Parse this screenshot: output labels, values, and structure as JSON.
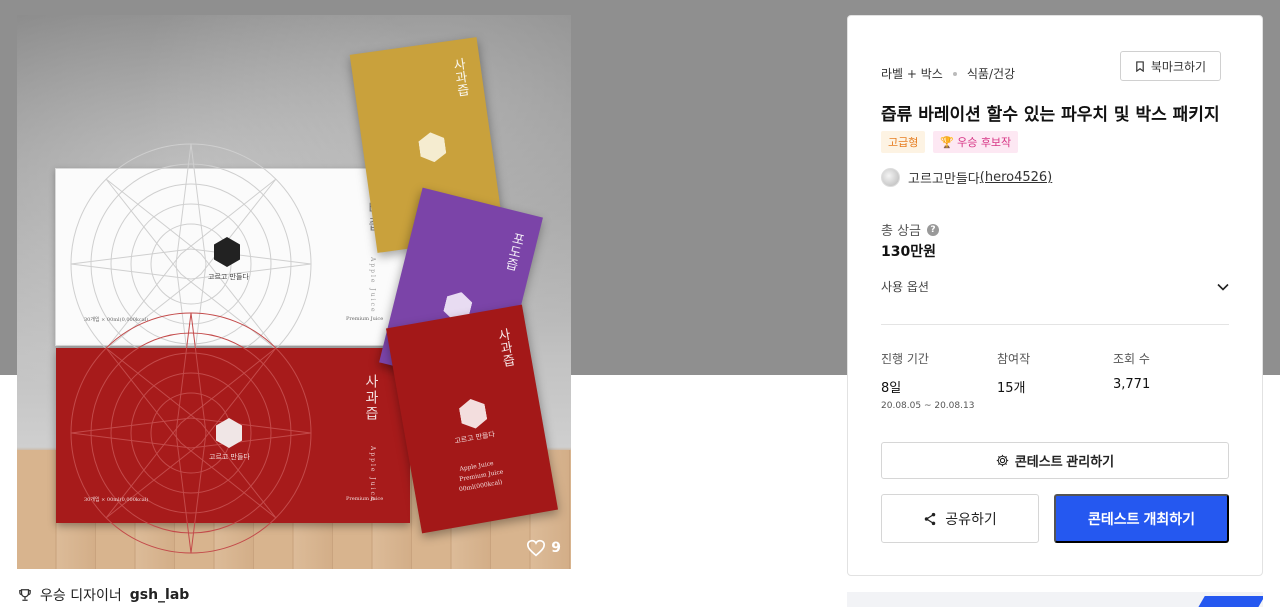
{
  "hero": {
    "likes": "9",
    "white_box": {
      "label": "배즙",
      "sub_label": "Apple Juice",
      "brand": "고르고 만들다",
      "spec": "30개입 × 00ml(0,000kcal)",
      "premium": "Premium Juice"
    },
    "red_box": {
      "label": "사과즙",
      "sub_label": "Apple Juice",
      "brand": "고르고 만들다",
      "spec": "30개입 × 00ml(0,000kcal)",
      "premium": "Premium Juice"
    },
    "gold_pouch": {
      "label": "사과즙"
    },
    "purple_pouch": {
      "label": "포도즙"
    },
    "red_pouch": {
      "label": "사과즙",
      "brand": "고르고 만들다",
      "line1": "Apple Juice",
      "line2": "Premium Juice",
      "line3": "00ml(000kcal)"
    }
  },
  "winner": {
    "prefix": "우승 디자이너",
    "name": "gsh_lab"
  },
  "panel": {
    "category": "라벨 + 박스",
    "subcategory": "식품/건강",
    "bookmark_label": "북마크하기",
    "title": "즙류 바레이션 할수 있는 파우치 및 박스 패키지",
    "tag_premium": "고급형",
    "tag_candidate": "우승 후보작",
    "designer_name": "고르고만들다",
    "designer_id": "(hero4526)",
    "prize_label": "총 상금",
    "prize_value": "130만원",
    "options_label": "사용 옵션",
    "stats": [
      {
        "label": "진행 기간",
        "value": "8일",
        "sub": "20.08.05 ~ 20.08.13"
      },
      {
        "label": "참여작",
        "value": "15개"
      },
      {
        "label": "조회 수",
        "value": "3,771"
      }
    ],
    "manage_label": "콘테스트 관리하기",
    "share_label": "공유하기",
    "host_label": "콘테스트 개최하기"
  }
}
